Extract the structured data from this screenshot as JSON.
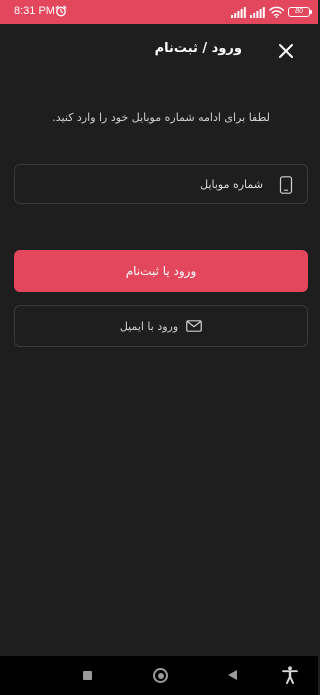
{
  "status_bar": {
    "time": "8:31 PM",
    "battery": "80",
    "icons": [
      "alarm-icon",
      "signal-icon",
      "signal-icon",
      "wifi-icon",
      "battery-icon"
    ]
  },
  "header": {
    "title": "ورود / ثبت‌نام",
    "close_icon": "close-icon"
  },
  "instruction": "لطفا برای ادامه شماره موبایل خود را وارد کنید.",
  "phone_field": {
    "placeholder": "شماره موبایل",
    "value": "",
    "icon": "phone-icon"
  },
  "buttons": {
    "submit_label": "ورود یا ثبت‌نام",
    "email_label": "ورود با ایمیل"
  },
  "nav_bar": {
    "icons": [
      "recents-icon",
      "home-icon",
      "back-icon",
      "accessibility-icon"
    ]
  },
  "colors": {
    "accent": "#e2475e",
    "background": "#1e1e1e",
    "nav_background": "#000000",
    "border": "#3a3a3a"
  }
}
